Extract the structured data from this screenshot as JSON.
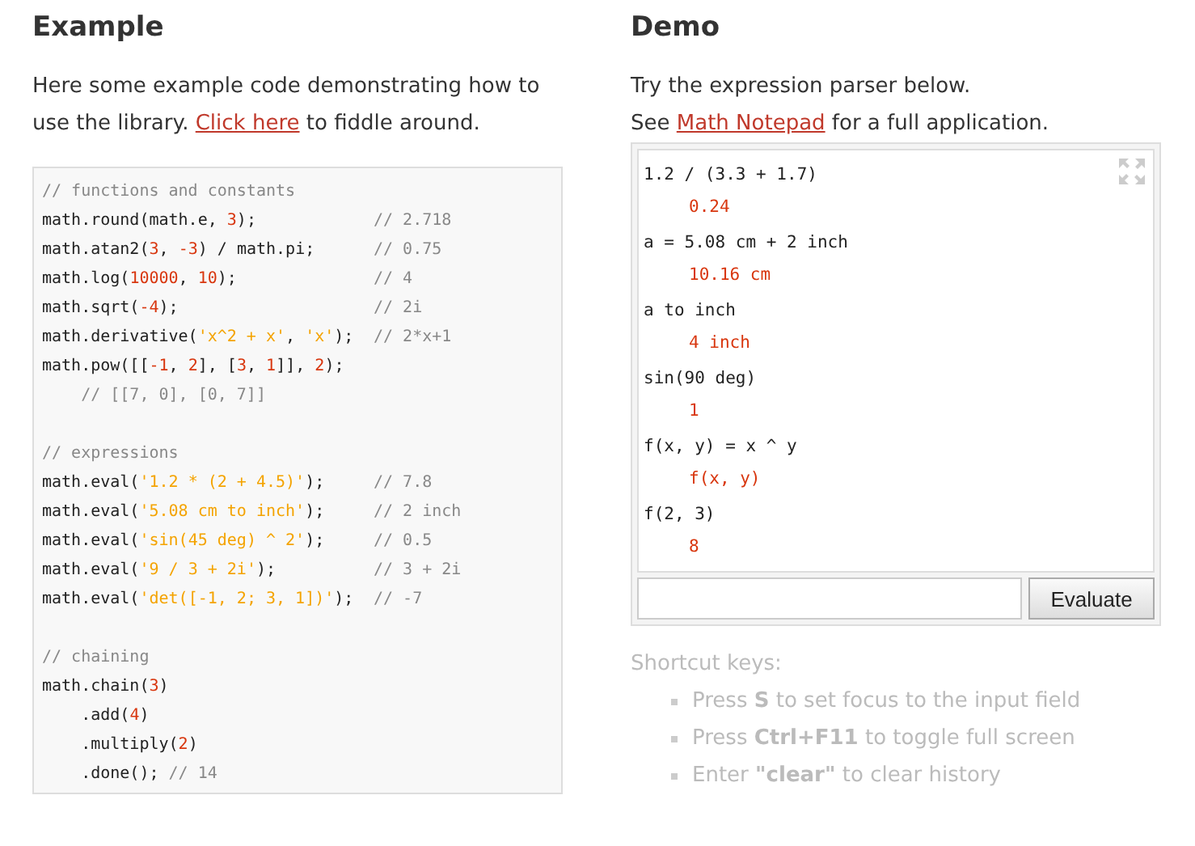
{
  "example": {
    "heading": "Example",
    "intro": {
      "before": "Here some example code demonstrating how to use the library. ",
      "link": "Click here",
      "after": " to fiddle around."
    },
    "code": [
      {
        "kind": "code",
        "tokens": [
          {
            "kind": "comment",
            "text": "// functions and constants"
          }
        ]
      },
      {
        "kind": "code",
        "tokens": [
          {
            "kind": "plain",
            "text": "math.round(math.e, "
          },
          {
            "kind": "number",
            "text": "3"
          },
          {
            "kind": "plain",
            "text": ");"
          }
        ],
        "note": "// 2.718"
      },
      {
        "kind": "code",
        "tokens": [
          {
            "kind": "plain",
            "text": "math.atan2("
          },
          {
            "kind": "number",
            "text": "3"
          },
          {
            "kind": "plain",
            "text": ", "
          },
          {
            "kind": "number",
            "text": "-3"
          },
          {
            "kind": "plain",
            "text": ") / math.pi;"
          }
        ],
        "note": "// 0.75"
      },
      {
        "kind": "code",
        "tokens": [
          {
            "kind": "plain",
            "text": "math.log("
          },
          {
            "kind": "number",
            "text": "10000"
          },
          {
            "kind": "plain",
            "text": ", "
          },
          {
            "kind": "number",
            "text": "10"
          },
          {
            "kind": "plain",
            "text": ");"
          }
        ],
        "note": "// 4"
      },
      {
        "kind": "code",
        "tokens": [
          {
            "kind": "plain",
            "text": "math.sqrt("
          },
          {
            "kind": "number",
            "text": "-4"
          },
          {
            "kind": "plain",
            "text": ");"
          }
        ],
        "note": "// 2i"
      },
      {
        "kind": "code",
        "tokens": [
          {
            "kind": "plain",
            "text": "math.derivative("
          },
          {
            "kind": "string",
            "text": "'x^2 + x'"
          },
          {
            "kind": "plain",
            "text": ", "
          },
          {
            "kind": "string",
            "text": "'x'"
          },
          {
            "kind": "plain",
            "text": ");"
          }
        ],
        "note": "// 2*x+1"
      },
      {
        "kind": "code",
        "tokens": [
          {
            "kind": "plain",
            "text": "math.pow([["
          },
          {
            "kind": "number",
            "text": "-1"
          },
          {
            "kind": "plain",
            "text": ", "
          },
          {
            "kind": "number",
            "text": "2"
          },
          {
            "kind": "plain",
            "text": "], ["
          },
          {
            "kind": "number",
            "text": "3"
          },
          {
            "kind": "plain",
            "text": ", "
          },
          {
            "kind": "number",
            "text": "1"
          },
          {
            "kind": "plain",
            "text": "]], "
          },
          {
            "kind": "number",
            "text": "2"
          },
          {
            "kind": "plain",
            "text": ");"
          }
        ]
      },
      {
        "kind": "code",
        "tokens": [
          {
            "kind": "comment",
            "text": "    // [[7, 0], [0, 7]]"
          }
        ]
      },
      {
        "kind": "blank"
      },
      {
        "kind": "code",
        "tokens": [
          {
            "kind": "comment",
            "text": "// expressions"
          }
        ]
      },
      {
        "kind": "code",
        "tokens": [
          {
            "kind": "plain",
            "text": "math.eval("
          },
          {
            "kind": "string",
            "text": "'1.2 * (2 + 4.5)'"
          },
          {
            "kind": "plain",
            "text": ");"
          }
        ],
        "note": "// 7.8"
      },
      {
        "kind": "code",
        "tokens": [
          {
            "kind": "plain",
            "text": "math.eval("
          },
          {
            "kind": "string",
            "text": "'5.08 cm to inch'"
          },
          {
            "kind": "plain",
            "text": ");"
          }
        ],
        "note": "// 2 inch"
      },
      {
        "kind": "code",
        "tokens": [
          {
            "kind": "plain",
            "text": "math.eval("
          },
          {
            "kind": "string",
            "text": "'sin(45 deg) ^ 2'"
          },
          {
            "kind": "plain",
            "text": ");"
          }
        ],
        "note": "// 0.5"
      },
      {
        "kind": "code",
        "tokens": [
          {
            "kind": "plain",
            "text": "math.eval("
          },
          {
            "kind": "string",
            "text": "'9 / 3 + 2i'"
          },
          {
            "kind": "plain",
            "text": ");"
          }
        ],
        "note": "// 3 + 2i"
      },
      {
        "kind": "code",
        "tokens": [
          {
            "kind": "plain",
            "text": "math.eval("
          },
          {
            "kind": "string",
            "text": "'det([-1, 2; 3, 1])'"
          },
          {
            "kind": "plain",
            "text": ");"
          }
        ],
        "note": "// -7"
      },
      {
        "kind": "blank"
      },
      {
        "kind": "code",
        "tokens": [
          {
            "kind": "comment",
            "text": "// chaining"
          }
        ]
      },
      {
        "kind": "code",
        "tokens": [
          {
            "kind": "plain",
            "text": "math.chain("
          },
          {
            "kind": "number",
            "text": "3"
          },
          {
            "kind": "plain",
            "text": ")"
          }
        ]
      },
      {
        "kind": "code",
        "tokens": [
          {
            "kind": "plain",
            "text": "    .add("
          },
          {
            "kind": "number",
            "text": "4"
          },
          {
            "kind": "plain",
            "text": ")"
          }
        ]
      },
      {
        "kind": "code",
        "tokens": [
          {
            "kind": "plain",
            "text": "    .multiply("
          },
          {
            "kind": "number",
            "text": "2"
          },
          {
            "kind": "plain",
            "text": ")"
          }
        ]
      },
      {
        "kind": "code",
        "tokens": [
          {
            "kind": "plain",
            "text": "    .done(); "
          },
          {
            "kind": "comment",
            "text": "// 14"
          }
        ]
      }
    ]
  },
  "demo": {
    "heading": "Demo",
    "line1": "Try the expression parser below.",
    "line2": {
      "before": "See ",
      "link": "Math Notepad",
      "after": " for a full application."
    },
    "history": [
      {
        "expression": "1.2 / (3.3 + 1.7)",
        "result": "0.24"
      },
      {
        "expression": "a = 5.08 cm + 2 inch",
        "result": "10.16 cm"
      },
      {
        "expression": "a to inch",
        "result": "4 inch"
      },
      {
        "expression": "sin(90 deg)",
        "result": "1"
      },
      {
        "expression": "f(x, y) = x ^ y",
        "result": "f(x, y)"
      },
      {
        "expression": "f(2, 3)",
        "result": "8"
      }
    ],
    "button": "Evaluate",
    "shortcuts": {
      "title": "Shortcut keys:",
      "items": [
        "Press **S** to set focus to the input field",
        "Press **Ctrl+F11** to toggle full screen",
        "Enter **\"clear\"** to clear history"
      ]
    }
  }
}
